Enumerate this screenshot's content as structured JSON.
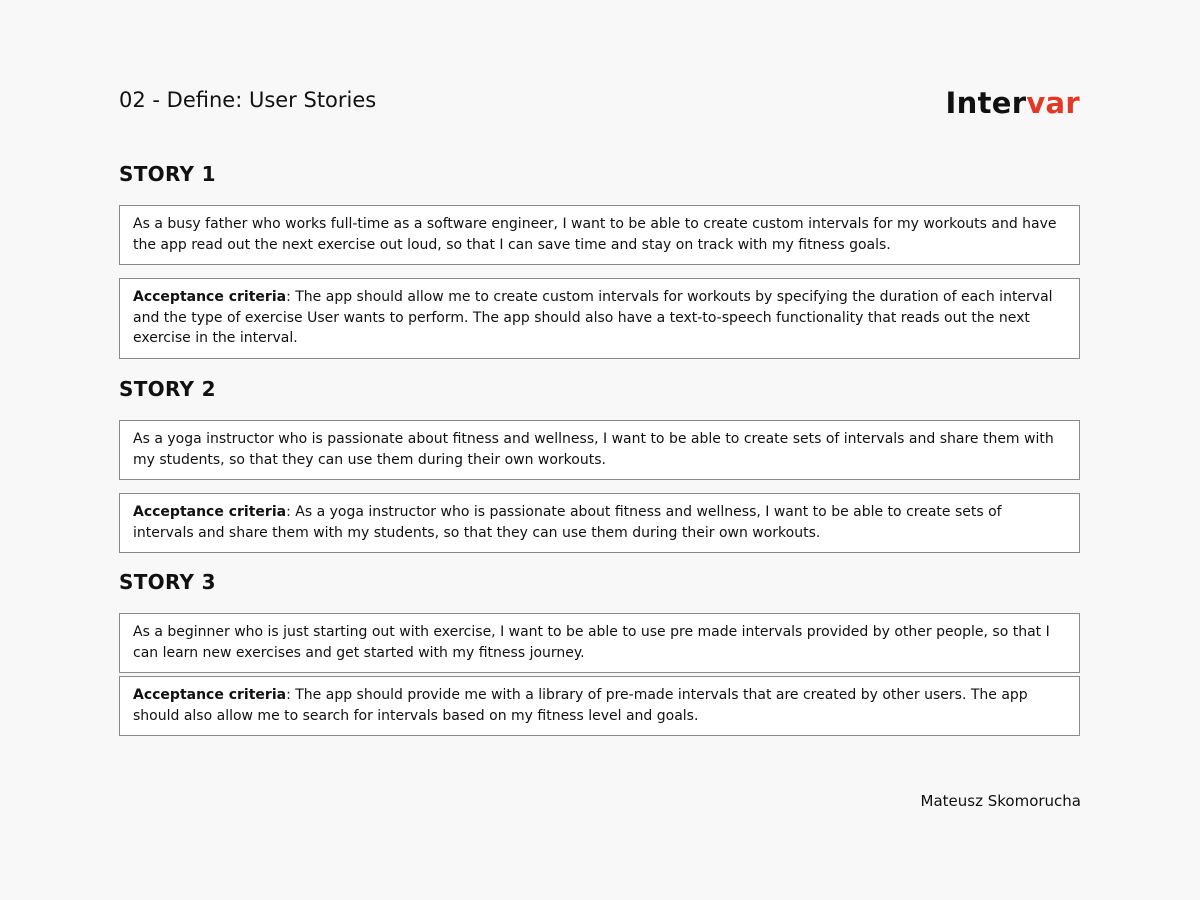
{
  "header": {
    "title": "02 - Define: User Stories",
    "logo_main": "Inter",
    "logo_accent": "var"
  },
  "colors": {
    "accent": "#e03a26",
    "text": "#111111",
    "background": "#f8f8f8",
    "box_border": "#8a8a8a"
  },
  "stories": [
    {
      "heading": "STORY 1",
      "story": "As a busy father who works full-time as a software engineer, I want to be able to create custom intervals for my workouts and have the app read out the next exercise out loud, so that I can save time and stay on track with my fitness goals.",
      "criteria_label": "Acceptance criteria",
      "criteria": ": The app should allow me to create custom intervals for workouts by specifying the duration of each interval and the type of exercise User wants to perform. The app should also have a text-to-speech functionality that reads out the next exercise in the interval."
    },
    {
      "heading": "STORY 2",
      "story": "As a yoga instructor who is passionate about fitness and wellness, I want to be able to create sets of intervals and share them with my students, so that they can use them during their own workouts.",
      "criteria_label": "Acceptance criteria",
      "criteria": ": As a yoga instructor who is passionate about fitness and wellness, I want to be able to create sets of intervals and share them with my students, so that they can use them during their own workouts."
    },
    {
      "heading": "STORY 3",
      "story": "As a beginner who is just starting out with exercise, I want to be able to use pre made intervals provided by other people, so that I can learn new exercises and get started with my fitness journey.",
      "criteria_label": "Acceptance criteria",
      "criteria": ": The app should provide me with a library of pre-made intervals that are created by other users. The app should also allow me to search for intervals based on my fitness level and goals."
    }
  ],
  "footer": {
    "author": "Mateusz Skomorucha"
  }
}
